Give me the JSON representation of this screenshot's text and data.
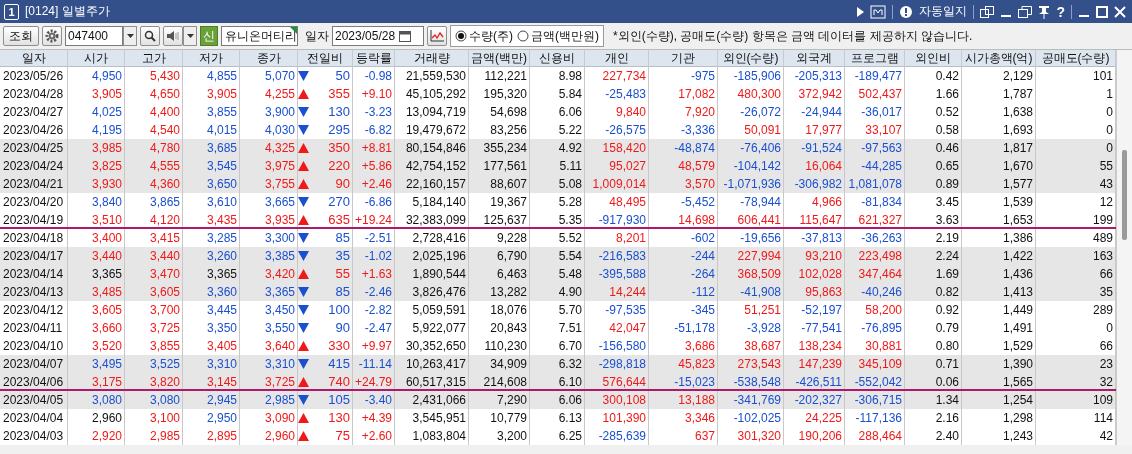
{
  "window": {
    "badge": "1",
    "title": "[0124] 일별주가",
    "autolog": "자동일지",
    "help": "?"
  },
  "toolbar": {
    "query_button": "조회",
    "code": "047400",
    "market_badge": "신",
    "stock_name": "유니온머티리",
    "date_label": "일자",
    "date": "2023/05/28",
    "modes": [
      {
        "label": "수량(주)",
        "selected": true
      },
      {
        "label": "금액(백만원)",
        "selected": false
      }
    ],
    "notice": "*외인(수량), 공매도(수량) 항목은 금액 데이터를 제공하지 않습니다."
  },
  "table": {
    "columns": [
      "일자",
      "시가",
      "고가",
      "저가",
      "종가",
      "전일비",
      "등락률",
      "거래량",
      "금액(백만)",
      "신용비",
      "개인",
      "기관",
      "외인(수량)",
      "외국계",
      "프로그램",
      "외인비",
      "시가총액(억)",
      "공매도(수량)"
    ],
    "rows": [
      {
        "shaded": false,
        "marked": false,
        "rising": false,
        "cells": [
          {
            "text": "2023/05/26"
          },
          {
            "text": "4,950",
            "color": "#1a4fd0"
          },
          {
            "text": "5,430",
            "color": "#f01818"
          },
          {
            "text": "4,855",
            "color": "#1a4fd0"
          },
          {
            "text": "5,070",
            "color": "#1a4fd0"
          },
          {
            "text": "50",
            "color": "#1a4fd0"
          },
          {
            "text": "-0.98",
            "color": "#1a4fd0"
          },
          {
            "text": "21,559,530"
          },
          {
            "text": "112,221"
          },
          {
            "text": "8.98"
          },
          {
            "text": "227,734",
            "color": "#f01818"
          },
          {
            "text": "-975",
            "color": "#1a4fd0"
          },
          {
            "text": "-185,906",
            "color": "#1a4fd0"
          },
          {
            "text": "-205,313",
            "color": "#1a4fd0"
          },
          {
            "text": "-189,477",
            "color": "#1a4fd0"
          },
          {
            "text": "0.42"
          },
          {
            "text": "2,129"
          },
          {
            "text": "101"
          }
        ]
      },
      {
        "shaded": false,
        "marked": false,
        "rising": true,
        "cells": [
          {
            "text": "2023/04/28"
          },
          {
            "text": "3,905",
            "color": "#f01818"
          },
          {
            "text": "4,650",
            "color": "#f01818"
          },
          {
            "text": "3,905",
            "color": "#f01818"
          },
          {
            "text": "4,255",
            "color": "#f01818"
          },
          {
            "text": "355",
            "color": "#f01818"
          },
          {
            "text": "+9.10",
            "color": "#f01818"
          },
          {
            "text": "45,105,292"
          },
          {
            "text": "195,320"
          },
          {
            "text": "5.84"
          },
          {
            "text": "-25,483",
            "color": "#1a4fd0"
          },
          {
            "text": "17,082",
            "color": "#f01818"
          },
          {
            "text": "480,300",
            "color": "#f01818"
          },
          {
            "text": "372,942",
            "color": "#f01818"
          },
          {
            "text": "502,437",
            "color": "#f01818"
          },
          {
            "text": "1.66"
          },
          {
            "text": "1,787"
          },
          {
            "text": "1"
          }
        ]
      },
      {
        "shaded": false,
        "marked": false,
        "rising": false,
        "cells": [
          {
            "text": "2023/04/27"
          },
          {
            "text": "4,025",
            "color": "#1a4fd0"
          },
          {
            "text": "4,400",
            "color": "#f01818"
          },
          {
            "text": "3,855",
            "color": "#1a4fd0"
          },
          {
            "text": "3,900",
            "color": "#1a4fd0"
          },
          {
            "text": "130",
            "color": "#1a4fd0"
          },
          {
            "text": "-3.23",
            "color": "#1a4fd0"
          },
          {
            "text": "13,094,719"
          },
          {
            "text": "54,698"
          },
          {
            "text": "6.06"
          },
          {
            "text": "9,840",
            "color": "#f01818"
          },
          {
            "text": "7,920",
            "color": "#f01818"
          },
          {
            "text": "-26,072",
            "color": "#1a4fd0"
          },
          {
            "text": "-24,944",
            "color": "#1a4fd0"
          },
          {
            "text": "-36,017",
            "color": "#1a4fd0"
          },
          {
            "text": "0.52"
          },
          {
            "text": "1,638"
          },
          {
            "text": "0"
          }
        ]
      },
      {
        "shaded": false,
        "marked": false,
        "rising": false,
        "cells": [
          {
            "text": "2023/04/26"
          },
          {
            "text": "4,195",
            "color": "#1a4fd0"
          },
          {
            "text": "4,540",
            "color": "#f01818"
          },
          {
            "text": "4,015",
            "color": "#1a4fd0"
          },
          {
            "text": "4,030",
            "color": "#1a4fd0"
          },
          {
            "text": "295",
            "color": "#1a4fd0"
          },
          {
            "text": "-6.82",
            "color": "#1a4fd0"
          },
          {
            "text": "19,479,672"
          },
          {
            "text": "83,256"
          },
          {
            "text": "5.22"
          },
          {
            "text": "-26,575",
            "color": "#1a4fd0"
          },
          {
            "text": "-3,336",
            "color": "#1a4fd0"
          },
          {
            "text": "50,091",
            "color": "#f01818"
          },
          {
            "text": "17,977",
            "color": "#f01818"
          },
          {
            "text": "33,107",
            "color": "#f01818"
          },
          {
            "text": "0.58"
          },
          {
            "text": "1,693"
          },
          {
            "text": "0"
          }
        ]
      },
      {
        "shaded": true,
        "marked": false,
        "rising": true,
        "cells": [
          {
            "text": "2023/04/25"
          },
          {
            "text": "3,985",
            "color": "#f01818"
          },
          {
            "text": "4,780",
            "color": "#f01818"
          },
          {
            "text": "3,685",
            "color": "#1a4fd0"
          },
          {
            "text": "4,325",
            "color": "#f01818"
          },
          {
            "text": "350",
            "color": "#f01818"
          },
          {
            "text": "+8.81",
            "color": "#f01818"
          },
          {
            "text": "80,154,846"
          },
          {
            "text": "355,234"
          },
          {
            "text": "4.92"
          },
          {
            "text": "158,420",
            "color": "#f01818"
          },
          {
            "text": "-48,874",
            "color": "#1a4fd0"
          },
          {
            "text": "-76,406",
            "color": "#1a4fd0"
          },
          {
            "text": "-91,524",
            "color": "#1a4fd0"
          },
          {
            "text": "-97,563",
            "color": "#1a4fd0"
          },
          {
            "text": "0.46"
          },
          {
            "text": "1,817"
          },
          {
            "text": "0"
          }
        ]
      },
      {
        "shaded": true,
        "marked": false,
        "rising": true,
        "cells": [
          {
            "text": "2023/04/24"
          },
          {
            "text": "3,825",
            "color": "#f01818"
          },
          {
            "text": "4,555",
            "color": "#f01818"
          },
          {
            "text": "3,545",
            "color": "#1a4fd0"
          },
          {
            "text": "3,975",
            "color": "#f01818"
          },
          {
            "text": "220",
            "color": "#f01818"
          },
          {
            "text": "+5.86",
            "color": "#f01818"
          },
          {
            "text": "42,754,152"
          },
          {
            "text": "177,561"
          },
          {
            "text": "5.11"
          },
          {
            "text": "95,027",
            "color": "#f01818"
          },
          {
            "text": "48,579",
            "color": "#f01818"
          },
          {
            "text": "-104,142",
            "color": "#1a4fd0"
          },
          {
            "text": "16,064",
            "color": "#f01818"
          },
          {
            "text": "-44,285",
            "color": "#1a4fd0"
          },
          {
            "text": "0.65"
          },
          {
            "text": "1,670"
          },
          {
            "text": "55"
          }
        ]
      },
      {
        "shaded": true,
        "marked": false,
        "rising": true,
        "cells": [
          {
            "text": "2023/04/21"
          },
          {
            "text": "3,930",
            "color": "#f01818"
          },
          {
            "text": "4,360",
            "color": "#f01818"
          },
          {
            "text": "3,650",
            "color": "#1a4fd0"
          },
          {
            "text": "3,755",
            "color": "#f01818"
          },
          {
            "text": "90",
            "color": "#f01818"
          },
          {
            "text": "+2.46",
            "color": "#f01818"
          },
          {
            "text": "22,160,157"
          },
          {
            "text": "88,607"
          },
          {
            "text": "5.08"
          },
          {
            "text": "1,009,014",
            "color": "#f01818"
          },
          {
            "text": "3,570",
            "color": "#f01818"
          },
          {
            "text": "-1,071,936",
            "color": "#1a4fd0"
          },
          {
            "text": "-306,982",
            "color": "#1a4fd0"
          },
          {
            "text": "1,081,078",
            "color": "#1a4fd0"
          },
          {
            "text": "0.89"
          },
          {
            "text": "1,577"
          },
          {
            "text": "43"
          }
        ]
      },
      {
        "shaded": false,
        "marked": false,
        "rising": false,
        "cells": [
          {
            "text": "2023/04/20"
          },
          {
            "text": "3,840",
            "color": "#1a4fd0"
          },
          {
            "text": "3,865",
            "color": "#1a4fd0"
          },
          {
            "text": "3,610",
            "color": "#1a4fd0"
          },
          {
            "text": "3,665",
            "color": "#1a4fd0"
          },
          {
            "text": "270",
            "color": "#1a4fd0"
          },
          {
            "text": "-6.86",
            "color": "#1a4fd0"
          },
          {
            "text": "5,184,140"
          },
          {
            "text": "19,367"
          },
          {
            "text": "5.28"
          },
          {
            "text": "48,495",
            "color": "#f01818"
          },
          {
            "text": "-5,452",
            "color": "#1a4fd0"
          },
          {
            "text": "-78,944",
            "color": "#1a4fd0"
          },
          {
            "text": "4,966",
            "color": "#f01818"
          },
          {
            "text": "-81,834",
            "color": "#1a4fd0"
          },
          {
            "text": "3.45"
          },
          {
            "text": "1,539"
          },
          {
            "text": "12"
          }
        ]
      },
      {
        "shaded": false,
        "marked": true,
        "rising": true,
        "cells": [
          {
            "text": "2023/04/19"
          },
          {
            "text": "3,510",
            "color": "#f01818"
          },
          {
            "text": "4,120",
            "color": "#f01818"
          },
          {
            "text": "3,435",
            "color": "#f01818"
          },
          {
            "text": "3,935",
            "color": "#f01818"
          },
          {
            "text": "635",
            "color": "#f01818"
          },
          {
            "text": "+19.24",
            "color": "#f01818"
          },
          {
            "text": "32,383,099"
          },
          {
            "text": "125,637"
          },
          {
            "text": "5.35"
          },
          {
            "text": "-917,930",
            "color": "#1a4fd0"
          },
          {
            "text": "14,698",
            "color": "#f01818"
          },
          {
            "text": "606,441",
            "color": "#f01818"
          },
          {
            "text": "115,647",
            "color": "#f01818"
          },
          {
            "text": "621,327",
            "color": "#f01818"
          },
          {
            "text": "3.63"
          },
          {
            "text": "1,653"
          },
          {
            "text": "199"
          }
        ]
      },
      {
        "shaded": false,
        "marked": false,
        "rising": false,
        "cells": [
          {
            "text": "2023/04/18"
          },
          {
            "text": "3,400",
            "color": "#f01818"
          },
          {
            "text": "3,415",
            "color": "#f01818"
          },
          {
            "text": "3,285",
            "color": "#1a4fd0"
          },
          {
            "text": "3,300",
            "color": "#1a4fd0"
          },
          {
            "text": "85",
            "color": "#1a4fd0"
          },
          {
            "text": "-2.51",
            "color": "#1a4fd0"
          },
          {
            "text": "2,728,416"
          },
          {
            "text": "9,228"
          },
          {
            "text": "5.52"
          },
          {
            "text": "8,201",
            "color": "#f01818"
          },
          {
            "text": "-602",
            "color": "#1a4fd0"
          },
          {
            "text": "-19,656",
            "color": "#1a4fd0"
          },
          {
            "text": "-37,813",
            "color": "#1a4fd0"
          },
          {
            "text": "-36,263",
            "color": "#1a4fd0"
          },
          {
            "text": "2.19"
          },
          {
            "text": "1,386"
          },
          {
            "text": "489"
          }
        ]
      },
      {
        "shaded": true,
        "marked": false,
        "rising": false,
        "cells": [
          {
            "text": "2023/04/17"
          },
          {
            "text": "3,440",
            "color": "#f01818"
          },
          {
            "text": "3,440",
            "color": "#f01818"
          },
          {
            "text": "3,260",
            "color": "#1a4fd0"
          },
          {
            "text": "3,385",
            "color": "#1a4fd0"
          },
          {
            "text": "35",
            "color": "#1a4fd0"
          },
          {
            "text": "-1.02",
            "color": "#1a4fd0"
          },
          {
            "text": "2,025,196"
          },
          {
            "text": "6,790"
          },
          {
            "text": "5.54"
          },
          {
            "text": "-216,583",
            "color": "#1a4fd0"
          },
          {
            "text": "-244",
            "color": "#1a4fd0"
          },
          {
            "text": "227,994",
            "color": "#f01818"
          },
          {
            "text": "93,210",
            "color": "#f01818"
          },
          {
            "text": "223,498",
            "color": "#f01818"
          },
          {
            "text": "2.24"
          },
          {
            "text": "1,422"
          },
          {
            "text": "163"
          }
        ]
      },
      {
        "shaded": true,
        "marked": false,
        "rising": true,
        "cells": [
          {
            "text": "2023/04/14"
          },
          {
            "text": "3,365",
            "color": "#111111"
          },
          {
            "text": "3,470",
            "color": "#f01818"
          },
          {
            "text": "3,365",
            "color": "#111111"
          },
          {
            "text": "3,420",
            "color": "#f01818"
          },
          {
            "text": "55",
            "color": "#f01818"
          },
          {
            "text": "+1.63",
            "color": "#f01818"
          },
          {
            "text": "1,890,544"
          },
          {
            "text": "6,463"
          },
          {
            "text": "5.48"
          },
          {
            "text": "-395,588",
            "color": "#1a4fd0"
          },
          {
            "text": "-264",
            "color": "#1a4fd0"
          },
          {
            "text": "368,509",
            "color": "#f01818"
          },
          {
            "text": "102,028",
            "color": "#f01818"
          },
          {
            "text": "347,464",
            "color": "#f01818"
          },
          {
            "text": "1.69"
          },
          {
            "text": "1,436"
          },
          {
            "text": "66"
          }
        ]
      },
      {
        "shaded": true,
        "marked": false,
        "rising": false,
        "cells": [
          {
            "text": "2023/04/13"
          },
          {
            "text": "3,485",
            "color": "#f01818"
          },
          {
            "text": "3,605",
            "color": "#f01818"
          },
          {
            "text": "3,360",
            "color": "#1a4fd0"
          },
          {
            "text": "3,365",
            "color": "#1a4fd0"
          },
          {
            "text": "85",
            "color": "#1a4fd0"
          },
          {
            "text": "-2.46",
            "color": "#1a4fd0"
          },
          {
            "text": "3,826,476"
          },
          {
            "text": "13,282"
          },
          {
            "text": "4.90"
          },
          {
            "text": "14,244",
            "color": "#f01818"
          },
          {
            "text": "-112",
            "color": "#1a4fd0"
          },
          {
            "text": "-41,908",
            "color": "#1a4fd0"
          },
          {
            "text": "95,863",
            "color": "#f01818"
          },
          {
            "text": "-40,246",
            "color": "#1a4fd0"
          },
          {
            "text": "0.82"
          },
          {
            "text": "1,413"
          },
          {
            "text": "35"
          }
        ]
      },
      {
        "shaded": false,
        "marked": false,
        "rising": false,
        "cells": [
          {
            "text": "2023/04/12"
          },
          {
            "text": "3,605",
            "color": "#f01818"
          },
          {
            "text": "3,700",
            "color": "#f01818"
          },
          {
            "text": "3,445",
            "color": "#1a4fd0"
          },
          {
            "text": "3,450",
            "color": "#1a4fd0"
          },
          {
            "text": "100",
            "color": "#1a4fd0"
          },
          {
            "text": "-2.82",
            "color": "#1a4fd0"
          },
          {
            "text": "5,059,591"
          },
          {
            "text": "18,076"
          },
          {
            "text": "5.70"
          },
          {
            "text": "-97,535",
            "color": "#1a4fd0"
          },
          {
            "text": "-345",
            "color": "#1a4fd0"
          },
          {
            "text": "51,251",
            "color": "#f01818"
          },
          {
            "text": "-52,197",
            "color": "#1a4fd0"
          },
          {
            "text": "58,200",
            "color": "#f01818"
          },
          {
            "text": "0.92"
          },
          {
            "text": "1,449"
          },
          {
            "text": "289"
          }
        ]
      },
      {
        "shaded": false,
        "marked": false,
        "rising": false,
        "cells": [
          {
            "text": "2023/04/11"
          },
          {
            "text": "3,660",
            "color": "#f01818"
          },
          {
            "text": "3,725",
            "color": "#f01818"
          },
          {
            "text": "3,350",
            "color": "#1a4fd0"
          },
          {
            "text": "3,550",
            "color": "#1a4fd0"
          },
          {
            "text": "90",
            "color": "#1a4fd0"
          },
          {
            "text": "-2.47",
            "color": "#1a4fd0"
          },
          {
            "text": "5,922,077"
          },
          {
            "text": "20,843"
          },
          {
            "text": "7.51"
          },
          {
            "text": "42,047",
            "color": "#f01818"
          },
          {
            "text": "-51,178",
            "color": "#1a4fd0"
          },
          {
            "text": "-3,928",
            "color": "#1a4fd0"
          },
          {
            "text": "-77,541",
            "color": "#1a4fd0"
          },
          {
            "text": "-76,895",
            "color": "#1a4fd0"
          },
          {
            "text": "0.79"
          },
          {
            "text": "1,491"
          },
          {
            "text": "0"
          }
        ]
      },
      {
        "shaded": false,
        "marked": false,
        "rising": true,
        "cells": [
          {
            "text": "2023/04/10"
          },
          {
            "text": "3,520",
            "color": "#f01818"
          },
          {
            "text": "3,855",
            "color": "#f01818"
          },
          {
            "text": "3,405",
            "color": "#f01818"
          },
          {
            "text": "3,640",
            "color": "#f01818"
          },
          {
            "text": "330",
            "color": "#f01818"
          },
          {
            "text": "+9.97",
            "color": "#f01818"
          },
          {
            "text": "30,352,650"
          },
          {
            "text": "110,230"
          },
          {
            "text": "6.70"
          },
          {
            "text": "-156,580",
            "color": "#1a4fd0"
          },
          {
            "text": "3,686",
            "color": "#f01818"
          },
          {
            "text": "38,687",
            "color": "#f01818"
          },
          {
            "text": "138,234",
            "color": "#f01818"
          },
          {
            "text": "30,881",
            "color": "#f01818"
          },
          {
            "text": "0.80"
          },
          {
            "text": "1,529"
          },
          {
            "text": "66"
          }
        ]
      },
      {
        "shaded": true,
        "marked": false,
        "rising": false,
        "cells": [
          {
            "text": "2023/04/07"
          },
          {
            "text": "3,495",
            "color": "#1a4fd0"
          },
          {
            "text": "3,525",
            "color": "#1a4fd0"
          },
          {
            "text": "3,310",
            "color": "#1a4fd0"
          },
          {
            "text": "3,310",
            "color": "#1a4fd0"
          },
          {
            "text": "415",
            "color": "#1a4fd0"
          },
          {
            "text": "-11.14",
            "color": "#1a4fd0"
          },
          {
            "text": "10,263,417"
          },
          {
            "text": "34,909"
          },
          {
            "text": "6.32"
          },
          {
            "text": "-298,818",
            "color": "#1a4fd0"
          },
          {
            "text": "45,823",
            "color": "#f01818"
          },
          {
            "text": "273,543",
            "color": "#f01818"
          },
          {
            "text": "147,239",
            "color": "#f01818"
          },
          {
            "text": "345,109",
            "color": "#f01818"
          },
          {
            "text": "0.71"
          },
          {
            "text": "1,390"
          },
          {
            "text": "23"
          }
        ]
      },
      {
        "shaded": true,
        "marked": true,
        "rising": true,
        "cells": [
          {
            "text": "2023/04/06"
          },
          {
            "text": "3,175",
            "color": "#f01818"
          },
          {
            "text": "3,820",
            "color": "#f01818"
          },
          {
            "text": "3,145",
            "color": "#f01818"
          },
          {
            "text": "3,725",
            "color": "#f01818"
          },
          {
            "text": "740",
            "color": "#f01818"
          },
          {
            "text": "+24.79",
            "color": "#f01818"
          },
          {
            "text": "60,517,315"
          },
          {
            "text": "214,608"
          },
          {
            "text": "6.10"
          },
          {
            "text": "576,644",
            "color": "#f01818"
          },
          {
            "text": "-15,023",
            "color": "#1a4fd0"
          },
          {
            "text": "-538,548",
            "color": "#1a4fd0"
          },
          {
            "text": "-426,511",
            "color": "#1a4fd0"
          },
          {
            "text": "-552,042",
            "color": "#1a4fd0"
          },
          {
            "text": "0.06"
          },
          {
            "text": "1,565"
          },
          {
            "text": "32"
          }
        ]
      },
      {
        "shaded": true,
        "marked": false,
        "rising": false,
        "cells": [
          {
            "text": "2023/04/05"
          },
          {
            "text": "3,080",
            "color": "#1a4fd0"
          },
          {
            "text": "3,080",
            "color": "#1a4fd0"
          },
          {
            "text": "2,945",
            "color": "#1a4fd0"
          },
          {
            "text": "2,985",
            "color": "#1a4fd0"
          },
          {
            "text": "105",
            "color": "#1a4fd0"
          },
          {
            "text": "-3.40",
            "color": "#1a4fd0"
          },
          {
            "text": "2,431,066"
          },
          {
            "text": "7,290"
          },
          {
            "text": "6.06"
          },
          {
            "text": "300,108",
            "color": "#f01818"
          },
          {
            "text": "13,188",
            "color": "#f01818"
          },
          {
            "text": "-341,769",
            "color": "#1a4fd0"
          },
          {
            "text": "-202,327",
            "color": "#1a4fd0"
          },
          {
            "text": "-306,715",
            "color": "#1a4fd0"
          },
          {
            "text": "1.34"
          },
          {
            "text": "1,254"
          },
          {
            "text": "109"
          }
        ]
      },
      {
        "shaded": false,
        "marked": false,
        "rising": true,
        "cells": [
          {
            "text": "2023/04/04"
          },
          {
            "text": "2,960",
            "color": "#111111"
          },
          {
            "text": "3,100",
            "color": "#f01818"
          },
          {
            "text": "2,950",
            "color": "#1a4fd0"
          },
          {
            "text": "3,090",
            "color": "#f01818"
          },
          {
            "text": "130",
            "color": "#f01818"
          },
          {
            "text": "+4.39",
            "color": "#f01818"
          },
          {
            "text": "3,545,951"
          },
          {
            "text": "10,779"
          },
          {
            "text": "6.13"
          },
          {
            "text": "101,390",
            "color": "#f01818"
          },
          {
            "text": "3,346",
            "color": "#f01818"
          },
          {
            "text": "-102,025",
            "color": "#1a4fd0"
          },
          {
            "text": "24,225",
            "color": "#f01818"
          },
          {
            "text": "-117,136",
            "color": "#1a4fd0"
          },
          {
            "text": "2.16"
          },
          {
            "text": "1,298"
          },
          {
            "text": "114"
          }
        ]
      },
      {
        "shaded": false,
        "marked": false,
        "rising": true,
        "cells": [
          {
            "text": "2023/04/03"
          },
          {
            "text": "2,920",
            "color": "#f01818"
          },
          {
            "text": "2,985",
            "color": "#f01818"
          },
          {
            "text": "2,895",
            "color": "#f01818"
          },
          {
            "text": "2,960",
            "color": "#f01818"
          },
          {
            "text": "75",
            "color": "#f01818"
          },
          {
            "text": "+2.60",
            "color": "#f01818"
          },
          {
            "text": "1,083,804"
          },
          {
            "text": "3,200"
          },
          {
            "text": "6.25"
          },
          {
            "text": "-285,639",
            "color": "#1a4fd0"
          },
          {
            "text": "637",
            "color": "#f01818"
          },
          {
            "text": "301,320",
            "color": "#f01818"
          },
          {
            "text": "190,206",
            "color": "#f01818"
          },
          {
            "text": "288,464",
            "color": "#f01818"
          },
          {
            "text": "2.40"
          },
          {
            "text": "1,243"
          },
          {
            "text": "42"
          }
        ]
      }
    ]
  }
}
